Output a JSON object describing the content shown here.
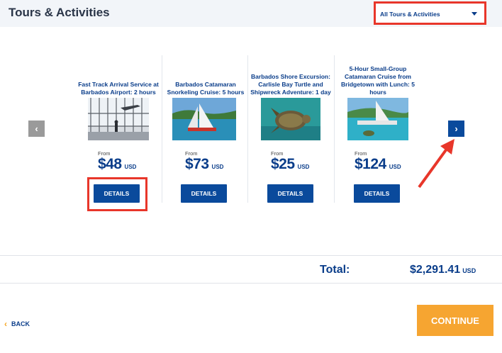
{
  "header": {
    "title": "Tours & Activities",
    "filter": {
      "selected": "All Tours & Activities"
    }
  },
  "carousel": {
    "prev_icon": "chevron-left-icon",
    "next_icon": "chevron-right-icon",
    "tours": [
      {
        "title": "Fast Track Arrival Service at Barbados Airport: 2 hours",
        "from": "From",
        "price": "$48",
        "currency": "USD",
        "details": "DETAILS",
        "image": "airport-terminal-photo"
      },
      {
        "title": "Barbados Catamaran Snorkeling Cruise: 5 hours",
        "from": "From",
        "price": "$73",
        "currency": "USD",
        "details": "DETAILS",
        "image": "catamaran-photo"
      },
      {
        "title": "Barbados Shore Excursion: Carlisle Bay Turtle and Shipwreck Adventure: 1 day",
        "from": "From",
        "price": "$25",
        "currency": "USD",
        "details": "DETAILS",
        "image": "sea-turtle-photo"
      },
      {
        "title": "5-Hour Small-Group Catamaran Cruise from Bridgetown with Lunch: 5 hours",
        "from": "From",
        "price": "$124",
        "currency": "USD",
        "details": "DETAILS",
        "image": "catamaran-bay-photo"
      }
    ]
  },
  "summary": {
    "total_label": "Total:",
    "total_value": "$2,291.41",
    "total_currency": "USD"
  },
  "footer": {
    "back_label": "BACK",
    "continue_label": "CONTINUE"
  },
  "colors": {
    "brand_blue": "#0a4a9c",
    "accent_orange": "#f6a531",
    "annotation_red": "#e8362a"
  }
}
